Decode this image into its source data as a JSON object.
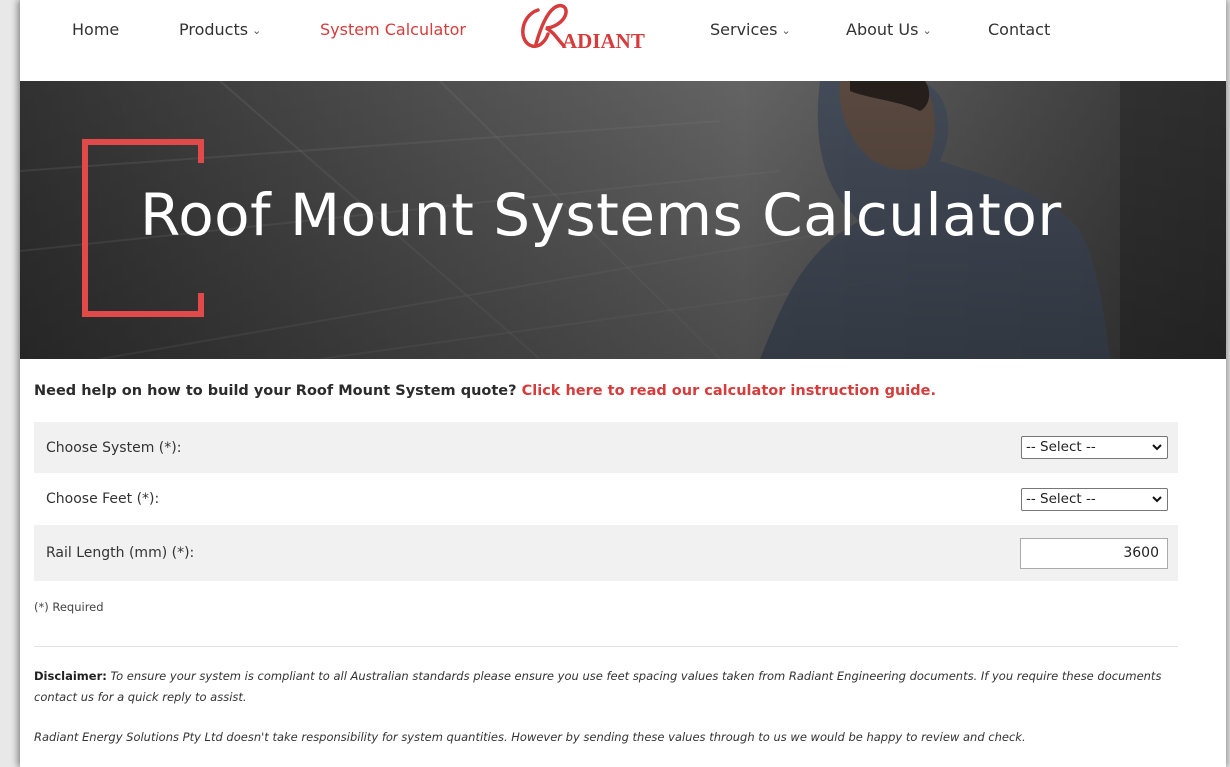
{
  "nav": {
    "home": "Home",
    "products": "Products",
    "system_calculator": "System Calculator",
    "services": "Services",
    "about_us": "About Us",
    "contact": "Contact",
    "logo_text": "ADIANT",
    "active_color": "#d63c3c"
  },
  "hero": {
    "title": "Roof Mount Systems Calculator",
    "bracket_color": "#e24a4a"
  },
  "help": {
    "question": "Need help on how to build your Roof Mount System quote?",
    "link": "Click here to read our calculator instruction guide."
  },
  "form": {
    "system_label": "Choose System (*):",
    "system_value": "-- Select --",
    "feet_label": "Choose Feet (*):",
    "feet_value": "-- Select --",
    "rail_label": "Rail Length (mm) (*):",
    "rail_value": "3600",
    "required_note": "(*) Required"
  },
  "disclaimer": {
    "label": "Disclaimer:",
    "text": "To ensure your system is compliant to all Australian standards please ensure you use feet spacing values taken from Radiant Engineering documents. If you require these documents contact us for a quick reply to assist.",
    "note": "Radiant Energy Solutions Pty Ltd doesn't take responsibility for system quantities. However by sending these values through to us we would be happy to review and check."
  }
}
